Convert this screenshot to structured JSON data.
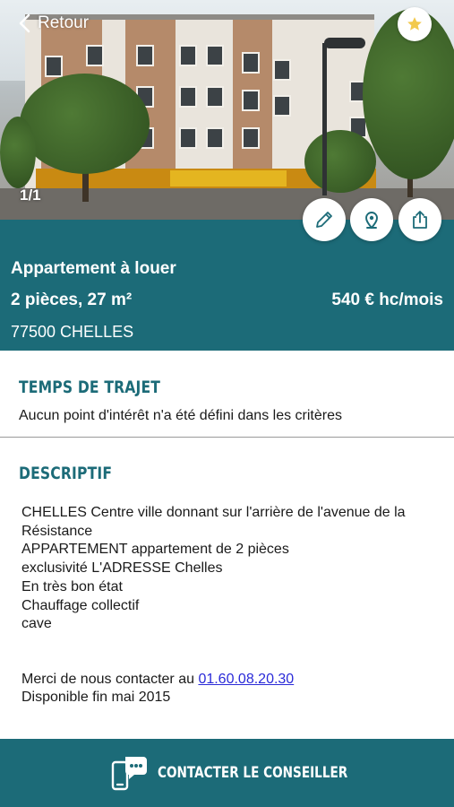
{
  "header": {
    "back_label": "Retour",
    "photo_counter": "1/1",
    "icons": [
      "back-chevron-icon",
      "star-icon",
      "pencil-icon",
      "map-pin-icon",
      "share-icon"
    ]
  },
  "listing": {
    "type": "Appartement à louer",
    "rooms_area": "2 pièces, 27 m²",
    "price": "540 € hc/mois",
    "city": "77500 CHELLES"
  },
  "travel": {
    "title": "TEMPS DE TRAJET",
    "text": "Aucun point d'intérêt n'a été défini dans les critères"
  },
  "description": {
    "title": "DESCRIPTIF",
    "lines": [
      "CHELLES Centre ville donnant sur l'arrière de l'avenue de la Résistance",
      "APPARTEMENT appartement de 2 pièces",
      "exclusivité L'ADRESSE Chelles",
      "En très bon état",
      "Chauffage collectif",
      "cave"
    ],
    "contact_prefix": "Merci de nous contacter au ",
    "phone": "01.60.08.20.30",
    "availability": "Disponible fin mai 2015"
  },
  "cta": {
    "label": "CONTACTER LE CONSEILLER",
    "icon": "phone-chat-icon"
  },
  "colors": {
    "primary": "#1c6b78",
    "star": "#f2c94c",
    "link": "#2a2ad8"
  }
}
